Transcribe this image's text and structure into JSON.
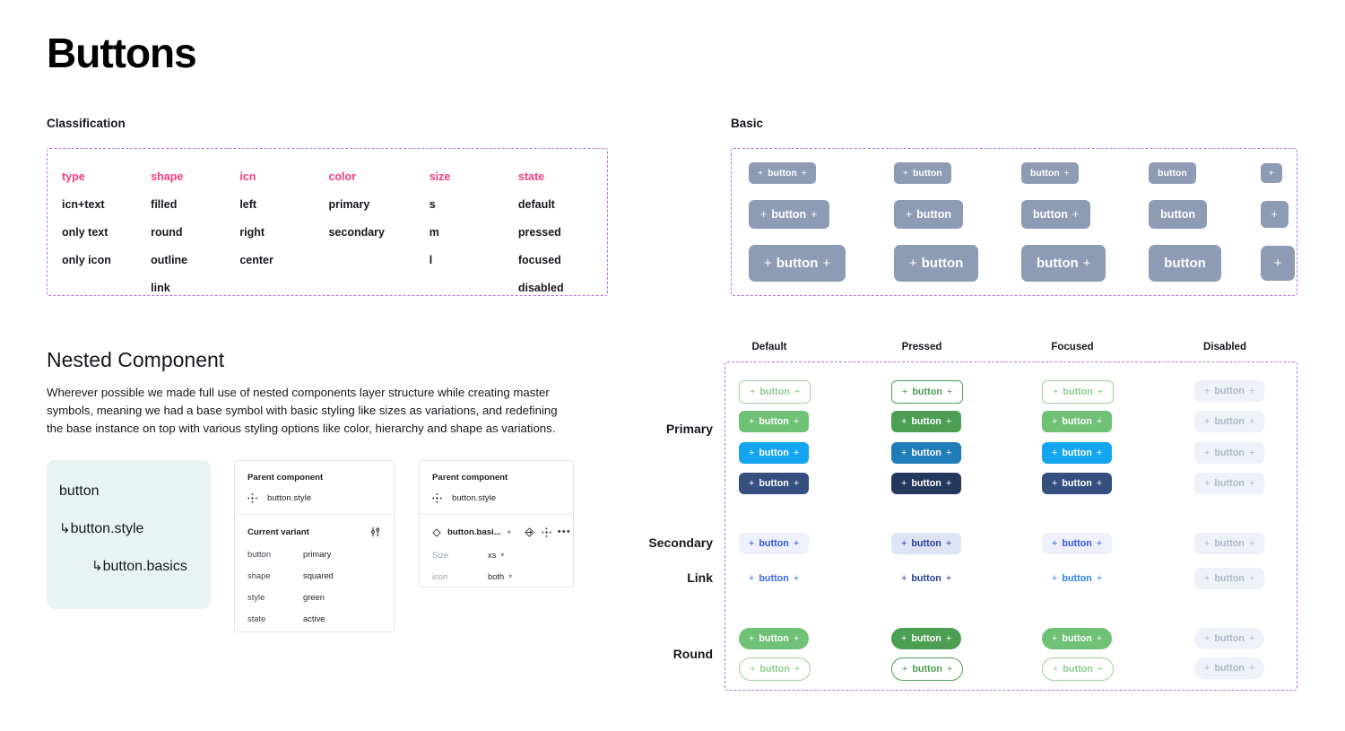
{
  "page": {
    "title": "Buttons"
  },
  "classification": {
    "label": "Classification",
    "columns": [
      {
        "head": "type",
        "items": [
          "icn+text",
          "only text",
          "only icon"
        ]
      },
      {
        "head": "shape",
        "items": [
          "filled",
          "round",
          "outline",
          "link"
        ]
      },
      {
        "head": "icn",
        "items": [
          "left",
          "right",
          "center"
        ]
      },
      {
        "head": "color",
        "items": [
          "primary",
          "secondary"
        ]
      },
      {
        "head": "size",
        "items": [
          "s",
          "m",
          "l"
        ]
      },
      {
        "head": "state",
        "items": [
          "default",
          "pressed",
          "focused",
          "disabled"
        ]
      }
    ]
  },
  "basic": {
    "label": "Basic",
    "icon_plus": "+",
    "button_label": "button",
    "sizes": [
      "sz-s",
      "sz-m",
      "sz-l"
    ],
    "variants": [
      "both",
      "left",
      "right",
      "none",
      "icon-only"
    ]
  },
  "nested": {
    "title": "Nested Component",
    "description": "Wherever possible we made full use of nested components layer structure while creating master symbols, meaning we had a base symbol with basic styling like sizes as variations, and redefining the base instance on top with various styling options like color, hierarchy and shape as variations.",
    "hierarchy": [
      {
        "arrow": "",
        "name": "button"
      },
      {
        "arrow": "↳",
        "name": "button.style"
      },
      {
        "arrow": "↳",
        "name": "button.basics"
      }
    ],
    "panel_one": {
      "parent_head": "Parent component",
      "parent_name": "button.style",
      "variant_head": "Current variant",
      "props": [
        {
          "key": "button",
          "value": "primary"
        },
        {
          "key": "shape",
          "value": "squared"
        },
        {
          "key": "style",
          "value": "green"
        },
        {
          "key": "state",
          "value": "active"
        }
      ]
    },
    "panel_two": {
      "parent_head": "Parent component",
      "parent_name": "button.style",
      "symbol_name": "button.basi...",
      "ellipsis": "•••",
      "props": [
        {
          "key": "Size",
          "value": "xs"
        },
        {
          "key": "icon",
          "value": "both"
        }
      ]
    }
  },
  "matrix": {
    "columns": [
      "Default",
      "Pressed",
      "Focused",
      "Disabled"
    ],
    "rows": [
      "Primary",
      "Secondary",
      "Link",
      "Round"
    ],
    "button_label": "button",
    "icon_plus": "+",
    "primary_variants": [
      "outline",
      "green",
      "blue",
      "navy"
    ],
    "round_variants": [
      "filled",
      "outline"
    ]
  },
  "colors": {
    "accent_pink": "#f73c77",
    "dashed_purple": "#b472e3",
    "basic_slate": "#8d9bb5",
    "green_default": "#6fc275",
    "green_pressed": "#4c9e52",
    "blue_default": "#13a5f0",
    "blue_pressed": "#1f7cb8",
    "navy_default": "#35507f",
    "navy_pressed": "#26375d",
    "disabled_bg": "#eef1f7",
    "disabled_text": "#aeb7c8",
    "secondary_bg": "#eef1fb",
    "secondary_text": "#3558d4",
    "link_text": "#3f6bf0",
    "hierarchy_card_bg": "#eaf3f3"
  }
}
